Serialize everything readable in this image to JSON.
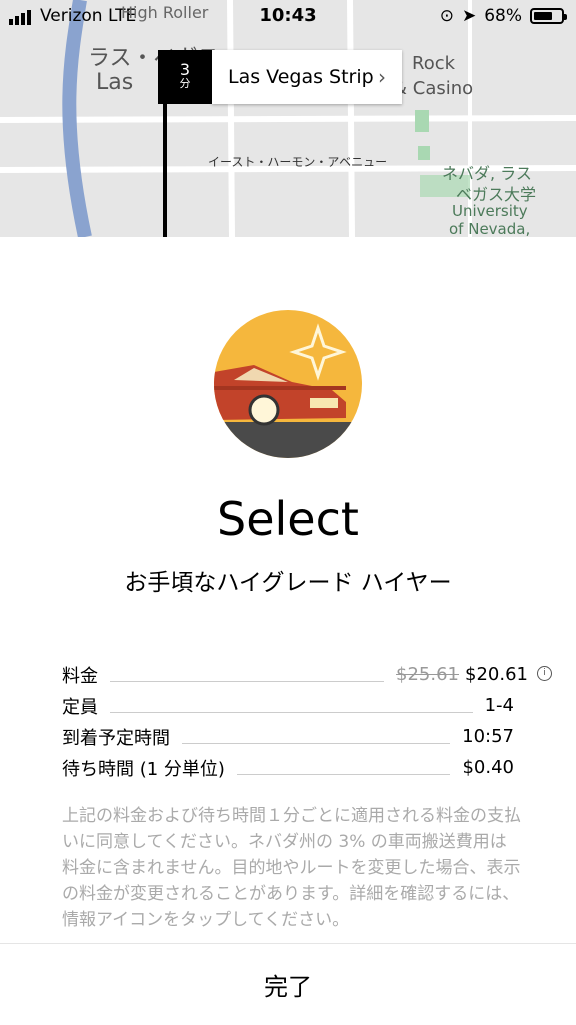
{
  "status_bar": {
    "carrier": "Verizon  LTE",
    "time": "10:43",
    "battery": "68%",
    "battery_level": 0.68
  },
  "map": {
    "labels": [
      "High Roller",
      "ラス・ベガス",
      "Las",
      "Rock",
      "& Casino",
      "イースト・ハーモン・アベニュー",
      "ネバダ, ラス",
      "ベガス大学",
      "University",
      "of Nevada,"
    ],
    "eta_number": "3",
    "eta_unit": "分",
    "destination": "Las Vegas Strip",
    "destination_chevron": "›"
  },
  "vehicle": {
    "name": "Select",
    "description": "お手頃なハイグレード ハイヤー"
  },
  "details": [
    {
      "label": "料金",
      "old_value": "$25.61",
      "value": "$20.61",
      "info": "i"
    },
    {
      "label": "定員",
      "value": "1-4"
    },
    {
      "label": "到着予定時間",
      "value": "10:57"
    },
    {
      "label": "待ち時間 (1 分単位)",
      "value": "$0.40"
    }
  ],
  "legal": "上記の料金および待ち時間１分ごとに適用される料金の支払いに同意してください。ネバダ州の 3% の車両搬送費用は料金に含まれません。目的地やルートを変更した場合、表示の料金が変更されることがあります。詳細を確認するには、情報アイコンをタップしてください。",
  "done_button": "完了",
  "colors": {
    "accent_bg": "#f5b73d",
    "car": "#c2432a",
    "map_bg": "#e6e6e6"
  }
}
